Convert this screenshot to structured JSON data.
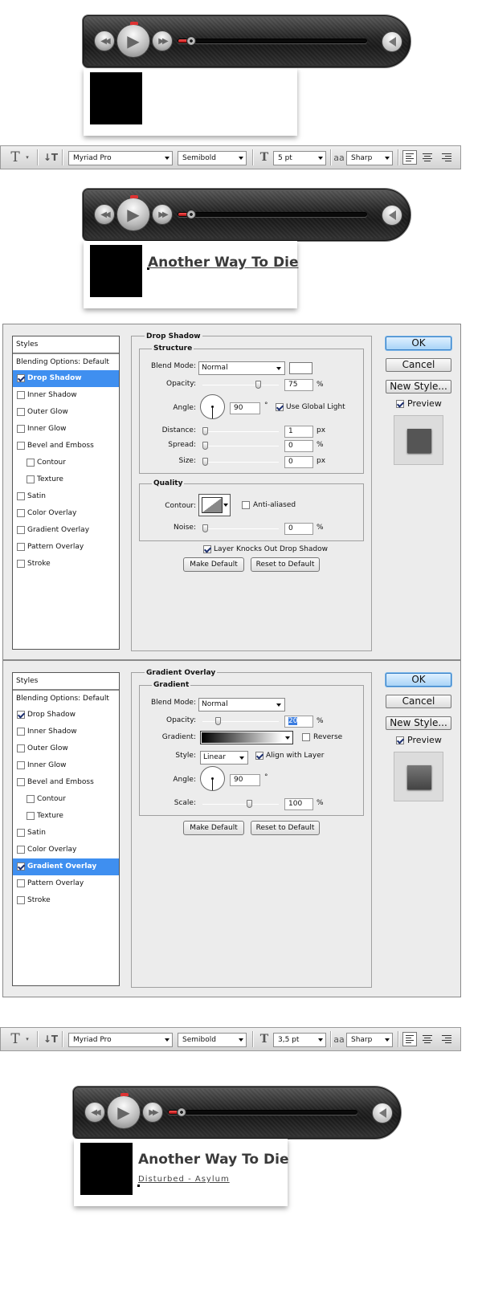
{
  "toolbar1": {
    "font_family": "Myriad Pro",
    "font_style": "Semibold",
    "font_size": "5 pt",
    "aa_icon": "aa",
    "antialias": "Sharp"
  },
  "toolbar2": {
    "font_family": "Myriad Pro",
    "font_style": "Semibold",
    "font_size": "3,5 pt",
    "aa_icon": "aa",
    "antialias": "Sharp"
  },
  "player": {
    "progress": 0.07
  },
  "song": {
    "title": "Another Way To Die",
    "subtitle": "Disturbed - Asylum"
  },
  "dialog_common": {
    "styles_header": "Styles",
    "blending_options": "Blending Options: Default",
    "items": [
      "Drop Shadow",
      "Inner Shadow",
      "Outer Glow",
      "Inner Glow",
      "Bevel and Emboss",
      "Contour",
      "Texture",
      "Satin",
      "Color Overlay",
      "Gradient Overlay",
      "Pattern Overlay",
      "Stroke"
    ],
    "ok": "OK",
    "cancel": "Cancel",
    "new_style": "New Style...",
    "preview": "Preview",
    "make_default": "Make Default",
    "reset_default": "Reset to Default"
  },
  "drop_shadow": {
    "title": "Drop Shadow",
    "structure": "Structure",
    "blend_mode_label": "Blend Mode:",
    "blend_mode": "Normal",
    "opacity_label": "Opacity:",
    "opacity": "75",
    "opacity_unit": "%",
    "angle_label": "Angle:",
    "angle": "90",
    "degree": "°",
    "use_global_light": "Use Global Light",
    "distance_label": "Distance:",
    "distance": "1",
    "spread_label": "Spread:",
    "spread": "0",
    "size_label": "Size:",
    "size": "0",
    "px": "px",
    "pct": "%",
    "quality": "Quality",
    "contour_label": "Contour:",
    "anti_aliased": "Anti-aliased",
    "noise_label": "Noise:",
    "noise": "0",
    "knockout": "Layer Knocks Out Drop Shadow"
  },
  "gradient_overlay": {
    "title": "Gradient Overlay",
    "gradient_group": "Gradient",
    "blend_mode_label": "Blend Mode:",
    "blend_mode": "Normal",
    "opacity_label": "Opacity:",
    "opacity": "20",
    "pct": "%",
    "gradient_label": "Gradient:",
    "reverse": "Reverse",
    "style_label": "Style:",
    "style": "Linear",
    "align_with_layer": "Align with Layer",
    "angle_label": "Angle:",
    "angle": "90",
    "degree": "°",
    "scale_label": "Scale:",
    "scale": "100"
  },
  "colors": {
    "selection": "#3f8ff0",
    "accent_red": "#d33333"
  }
}
